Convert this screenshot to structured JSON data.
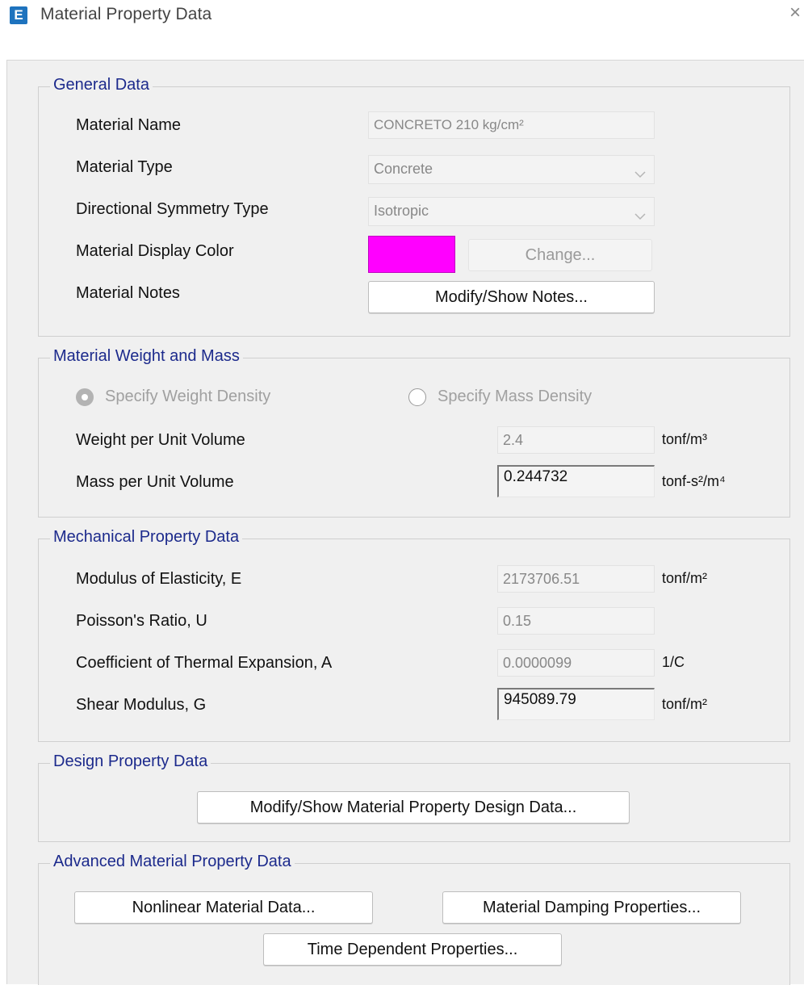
{
  "window": {
    "title": "Material Property Data",
    "app_icon_letter": "E",
    "close_glyph": "×"
  },
  "general": {
    "legend": "General Data",
    "material_name_label": "Material Name",
    "material_name_value": "CONCRETO 210 kg/cm²",
    "material_type_label": "Material Type",
    "material_type_value": "Concrete",
    "symmetry_label": "Directional Symmetry Type",
    "symmetry_value": "Isotropic",
    "display_color_label": "Material Display Color",
    "display_color": "#ff00ff",
    "change_button": "Change...",
    "notes_label": "Material Notes",
    "notes_button": "Modify/Show Notes..."
  },
  "weight_mass": {
    "legend": "Material Weight and Mass",
    "radio_weight_label": "Specify Weight Density",
    "radio_mass_label": "Specify Mass Density",
    "selected_option": "weight",
    "weight_label": "Weight per Unit Volume",
    "weight_value": "2.4",
    "weight_unit": "tonf/m³",
    "mass_label": "Mass per Unit Volume",
    "mass_value": "0.244732",
    "mass_unit": "tonf-s²/m⁴"
  },
  "mechanical": {
    "legend": "Mechanical Property Data",
    "modulus_label": "Modulus of Elasticity,  E",
    "modulus_value": "2173706.51",
    "modulus_unit": "tonf/m²",
    "poisson_label": "Poisson's Ratio,  U",
    "poisson_value": "0.15",
    "thermal_label": "Coefficient of Thermal Expansion,  A",
    "thermal_value": "0.0000099",
    "thermal_unit": "1/C",
    "shear_label": "Shear Modulus,  G",
    "shear_value": "945089.79",
    "shear_unit": "tonf/m²"
  },
  "design": {
    "legend": "Design Property Data",
    "button": "Modify/Show Material Property Design Data..."
  },
  "advanced": {
    "legend": "Advanced Material Property Data",
    "nonlinear_button": "Nonlinear Material Data...",
    "damping_button": "Material Damping Properties...",
    "time_button": "Time Dependent Properties..."
  },
  "colors": {
    "legend_text": "#1c2a8c",
    "dialog_bg": "#f0f0f0",
    "app_icon_bg": "#1e73be"
  }
}
